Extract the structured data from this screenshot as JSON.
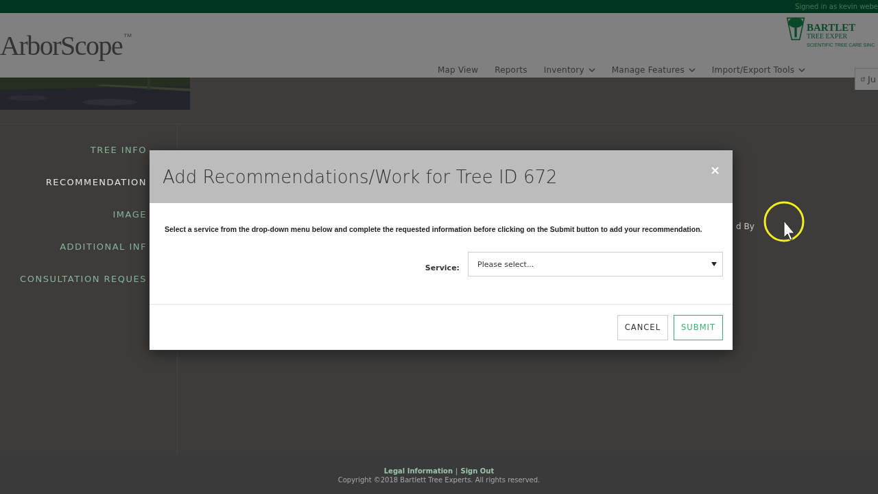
{
  "topbar": {
    "signed_in": "Signed in as kevin webe"
  },
  "header": {
    "logo": "ArborScope",
    "trademark": "TM",
    "brand": {
      "name": "BARTLET",
      "line": "TREE EXPER",
      "tagline": "SCIENTIFIC TREE CARE SINC"
    },
    "nav": [
      {
        "label": "Map View",
        "dropdown": false
      },
      {
        "label": "Reports",
        "dropdown": false
      },
      {
        "label": "Inventory",
        "dropdown": true
      },
      {
        "label": "Manage Features",
        "dropdown": true
      },
      {
        "label": "Import/Export Tools",
        "dropdown": true
      }
    ],
    "action_button": "Ju"
  },
  "side_nav": [
    {
      "label": "TREE INFO",
      "selected": false
    },
    {
      "label": "RECOMMENDATION",
      "selected": true
    },
    {
      "label": "IMAGE",
      "selected": false
    },
    {
      "label": "ADDITIONAL INF",
      "selected": false
    },
    {
      "label": "CONSULTATION REQUES",
      "selected": false
    }
  ],
  "content": {
    "label_fragment": "d By"
  },
  "modal": {
    "title": "Add Recommendations/Work for Tree ID 672",
    "close": "×",
    "instructions": "Select a service from the drop-down menu below and complete the requested information before clicking on the Submit button to add your recommendation.",
    "service_label": "Service:",
    "service_placeholder": "Please select...",
    "buttons": [
      {
        "label": "CANCEL",
        "kind": "secondary"
      },
      {
        "label": "SUBMIT",
        "kind": "primary"
      }
    ]
  },
  "footer": {
    "links": [
      "Legal Information",
      "Sign Out"
    ],
    "separator": "|",
    "copyright": "Copyright ©2018 Bartlett Tree Experts. All rights reserved."
  }
}
